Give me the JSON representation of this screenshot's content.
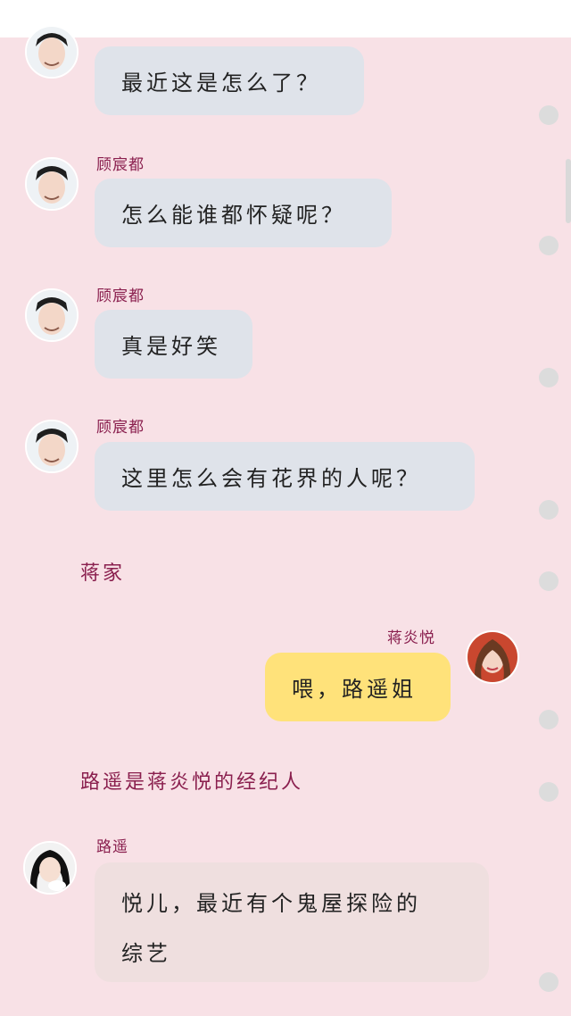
{
  "messages": [
    {
      "sender": "",
      "text": "最近这是怎么了？"
    },
    {
      "sender": "顾宸都",
      "text": "怎么能谁都怀疑呢？"
    },
    {
      "sender": "顾宸都",
      "text": "真是好笑"
    },
    {
      "sender": "顾宸都",
      "text": "这里怎么会有花界的人呢？"
    },
    {
      "sender": "蒋炎悦",
      "text": "喂，路遥姐"
    },
    {
      "sender": "路遥",
      "text": "悦儿，最近有个鬼屋探险的综艺"
    }
  ],
  "narrations": [
    "蒋家",
    "路遥是蒋炎悦的经纪人"
  ],
  "colors": {
    "background": "#f8e1e6",
    "gray_bubble": "#dfe3ea",
    "yellow_bubble": "#ffe27a",
    "beige_bubble": "#efdfdf",
    "name": "#8a1f4e"
  }
}
